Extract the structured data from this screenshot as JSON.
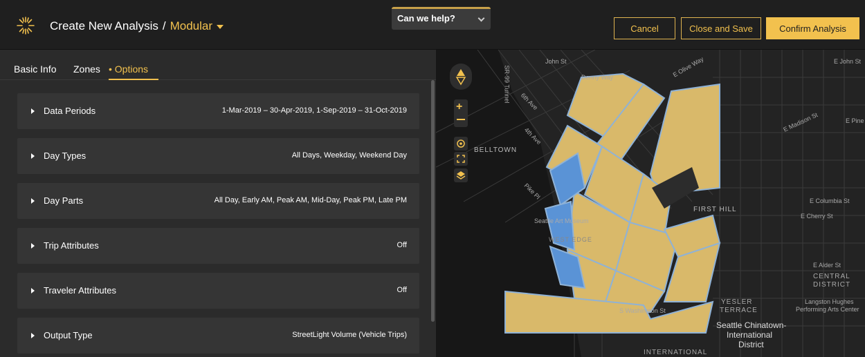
{
  "header": {
    "title": "Create New Analysis",
    "separator": "/",
    "mode": "Modular",
    "help_label": "Can we help?",
    "cancel_label": "Cancel",
    "close_save_label": "Close and Save",
    "confirm_label": "Confirm Analysis"
  },
  "tabs": [
    {
      "label": "Basic Info"
    },
    {
      "label": "Zones"
    },
    {
      "label": "• Options"
    }
  ],
  "options": [
    {
      "label": "Data Periods",
      "value": "1-Mar-2019 – 30-Apr-2019, 1-Sep-2019 – 31-Oct-2019"
    },
    {
      "label": "Day Types",
      "value": "All Days, Weekday, Weekend Day"
    },
    {
      "label": "Day Parts",
      "value": "All Day, Early AM, Peak AM, Mid-Day, Peak PM, Late PM"
    },
    {
      "label": "Trip Attributes",
      "value": "Off"
    },
    {
      "label": "Traveler Attributes",
      "value": "Off"
    },
    {
      "label": "Output Type",
      "value": "StreetLight Volume (Vehicle Trips)"
    }
  ],
  "map": {
    "labels": {
      "belltown": "BELLTOWN",
      "first_hill": "FIRST HILL",
      "central_district": "CENTRAL",
      "central_district2": "DISTRICT",
      "yesler": "YESLER",
      "terrace": "TERRACE",
      "chinatown": "Seattle Chinatown-",
      "chinatown2": "International",
      "chinatown3": "District",
      "international": "INTERNATIONAL",
      "e_john": "E John St",
      "john": "John St",
      "e_olive": "E Olive Way",
      "denny": "Denny Way",
      "e_madison": "E Madison St",
      "e_pine": "E Pine",
      "e_columbia": "E Columbia St",
      "e_cherry": "E Cherry St",
      "e_alder": "E Alder St",
      "langston": "Langston Hughes",
      "langston2": "Performing Arts Center",
      "sixth": "6th Ave",
      "fourth": "4th Ave",
      "pike": "Pike Pl",
      "sam": "Seattle Art Museum",
      "west_edge": "WEST EDGE",
      "s_washington": "S Washington St",
      "sr99": "SR-99 Tunnel"
    },
    "colors": {
      "zone_yellow": "#d9b96a",
      "zone_blue": "#5a93d6",
      "accent": "#f2c14e"
    }
  }
}
